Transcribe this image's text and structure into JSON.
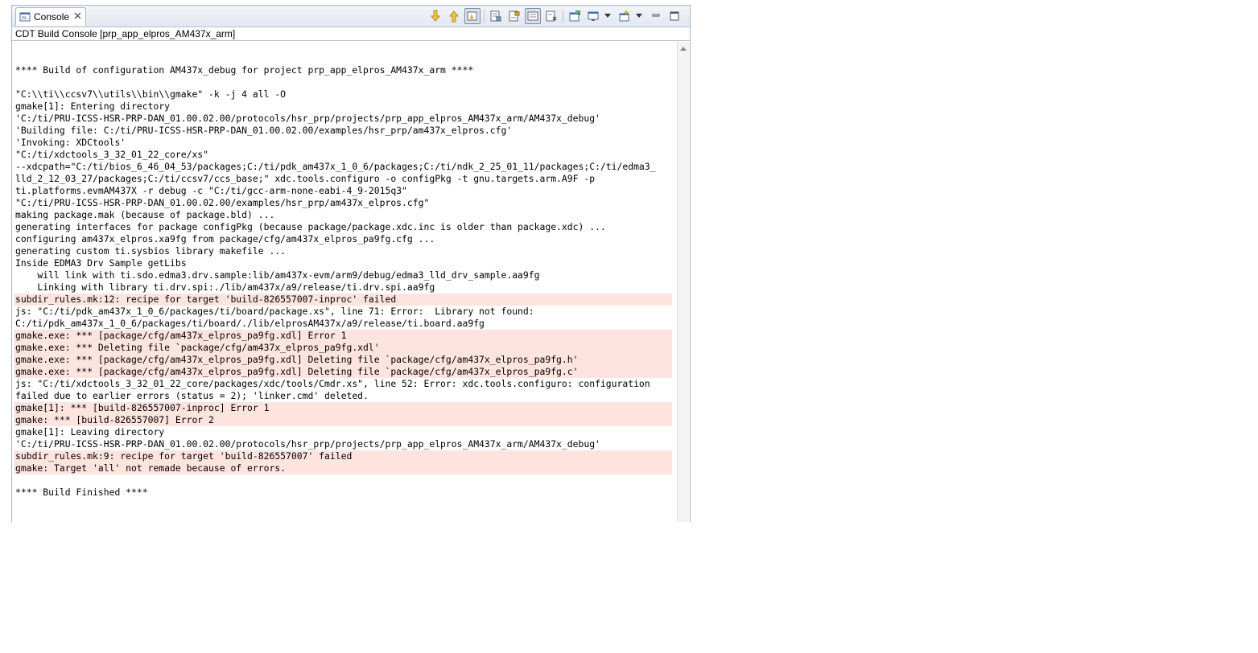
{
  "tab": {
    "label": "Console"
  },
  "console": {
    "title": "CDT Build Console [prp_app_elpros_AM437x_arm]",
    "lines": [
      {
        "text": "",
        "error": false
      },
      {
        "text": "**** Build of configuration AM437x_debug for project prp_app_elpros_AM437x_arm ****",
        "error": false
      },
      {
        "text": "",
        "error": false
      },
      {
        "text": "\"C:\\\\ti\\\\ccsv7\\\\utils\\\\bin\\\\gmake\" -k -j 4 all -O",
        "error": false
      },
      {
        "text": "gmake[1]: Entering directory",
        "error": false
      },
      {
        "text": "'C:/ti/PRU-ICSS-HSR-PRP-DAN_01.00.02.00/protocols/hsr_prp/projects/prp_app_elpros_AM437x_arm/AM437x_debug'",
        "error": false
      },
      {
        "text": "'Building file: C:/ti/PRU-ICSS-HSR-PRP-DAN_01.00.02.00/examples/hsr_prp/am437x_elpros.cfg'",
        "error": false
      },
      {
        "text": "'Invoking: XDCtools'",
        "error": false
      },
      {
        "text": "\"C:/ti/xdctools_3_32_01_22_core/xs\"",
        "error": false
      },
      {
        "text": "--xdcpath=\"C:/ti/bios_6_46_04_53/packages;C:/ti/pdk_am437x_1_0_6/packages;C:/ti/ndk_2_25_01_11/packages;C:/ti/edma3_",
        "error": false
      },
      {
        "text": "lld_2_12_03_27/packages;C:/ti/ccsv7/ccs_base;\" xdc.tools.configuro -o configPkg -t gnu.targets.arm.A9F -p",
        "error": false
      },
      {
        "text": "ti.platforms.evmAM437X -r debug -c \"C:/ti/gcc-arm-none-eabi-4_9-2015q3\"",
        "error": false
      },
      {
        "text": "\"C:/ti/PRU-ICSS-HSR-PRP-DAN_01.00.02.00/examples/hsr_prp/am437x_elpros.cfg\"",
        "error": false
      },
      {
        "text": "making package.mak (because of package.bld) ...",
        "error": false
      },
      {
        "text": "generating interfaces for package configPkg (because package/package.xdc.inc is older than package.xdc) ...",
        "error": false
      },
      {
        "text": "configuring am437x_elpros.xa9fg from package/cfg/am437x_elpros_pa9fg.cfg ...",
        "error": false
      },
      {
        "text": "generating custom ti.sysbios library makefile ...",
        "error": false
      },
      {
        "text": "Inside EDMA3 Drv Sample getLibs",
        "error": false
      },
      {
        "text": "    will link with ti.sdo.edma3.drv.sample:lib/am437x-evm/arm9/debug/edma3_lld_drv_sample.aa9fg",
        "error": false
      },
      {
        "text": "    Linking with library ti.drv.spi:./lib/am437x/a9/release/ti.drv.spi.aa9fg",
        "error": false
      },
      {
        "text": "subdir_rules.mk:12: recipe for target 'build-826557007-inproc' failed",
        "error": true
      },
      {
        "text": "js: \"C:/ti/pdk_am437x_1_0_6/packages/ti/board/package.xs\", line 71: Error:  Library not found:",
        "error": false
      },
      {
        "text": "C:/ti/pdk_am437x_1_0_6/packages/ti/board/./lib/elprosAM437x/a9/release/ti.board.aa9fg",
        "error": false
      },
      {
        "text": "gmake.exe: *** [package/cfg/am437x_elpros_pa9fg.xdl] Error 1",
        "error": true
      },
      {
        "text": "gmake.exe: *** Deleting file `package/cfg/am437x_elpros_pa9fg.xdl'",
        "error": true
      },
      {
        "text": "gmake.exe: *** [package/cfg/am437x_elpros_pa9fg.xdl] Deleting file `package/cfg/am437x_elpros_pa9fg.h'",
        "error": true
      },
      {
        "text": "gmake.exe: *** [package/cfg/am437x_elpros_pa9fg.xdl] Deleting file `package/cfg/am437x_elpros_pa9fg.c'",
        "error": true
      },
      {
        "text": "js: \"C:/ti/xdctools_3_32_01_22_core/packages/xdc/tools/Cmdr.xs\", line 52: Error: xdc.tools.configuro: configuration",
        "error": false
      },
      {
        "text": "failed due to earlier errors (status = 2); 'linker.cmd' deleted.",
        "error": false
      },
      {
        "text": "gmake[1]: *** [build-826557007-inproc] Error 1",
        "error": true
      },
      {
        "text": "gmake: *** [build-826557007] Error 2",
        "error": true
      },
      {
        "text": "gmake[1]: Leaving directory",
        "error": false
      },
      {
        "text": "'C:/ti/PRU-ICSS-HSR-PRP-DAN_01.00.02.00/protocols/hsr_prp/projects/prp_app_elpros_AM437x_arm/AM437x_debug'",
        "error": false
      },
      {
        "text": "subdir_rules.mk:9: recipe for target 'build-826557007' failed",
        "error": true
      },
      {
        "text": "gmake: Target 'all' not remade because of errors.",
        "error": true
      },
      {
        "text": "",
        "error": false
      },
      {
        "text": "**** Build Finished ****",
        "error": false
      }
    ]
  },
  "icons": {
    "tab": "console-icon",
    "close": "close-icon",
    "toolbar": [
      "scroll-down-icon",
      "scroll-up-icon",
      "scroll-lock-icon",
      "clear-console-icon",
      "word-wrap-icon",
      "show-console-icon",
      "pin-console-icon",
      "remove-launch-icon",
      "display-console-icon",
      "display-dropdown-icon",
      "open-console-icon",
      "open-dropdown-icon",
      "minimize-icon",
      "maximize-icon"
    ]
  },
  "colors": {
    "error_background": "#fde4df",
    "frame": "#a8b4c4"
  }
}
